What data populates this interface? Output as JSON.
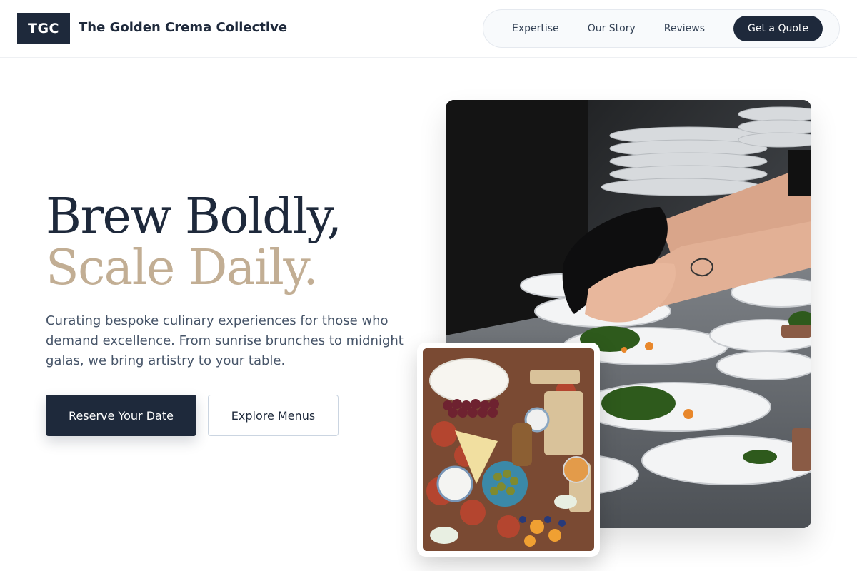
{
  "header": {
    "logo_text": "TGC",
    "brand_name": "The Golden Crema Collective",
    "nav": [
      {
        "label": "Expertise"
      },
      {
        "label": "Our Story"
      },
      {
        "label": "Reviews"
      }
    ],
    "cta_label": "Get a Quote"
  },
  "hero": {
    "headline_line1": "Brew Boldly,",
    "headline_line2": "Scale Daily.",
    "description": "Curating bespoke culinary experiences for those who demand excellence. From sunrise brunches to midnight galas, we bring artistry to your table.",
    "primary_button": "Reserve Your Date",
    "secondary_button": "Explore Menus"
  },
  "colors": {
    "navy": "#1e293b",
    "accent_tan": "#c2ae94",
    "body_text": "#475569"
  },
  "images": {
    "main_photo": "chef-plating-dishes-photo",
    "inset_photo": "charcuterie-board-photo"
  }
}
